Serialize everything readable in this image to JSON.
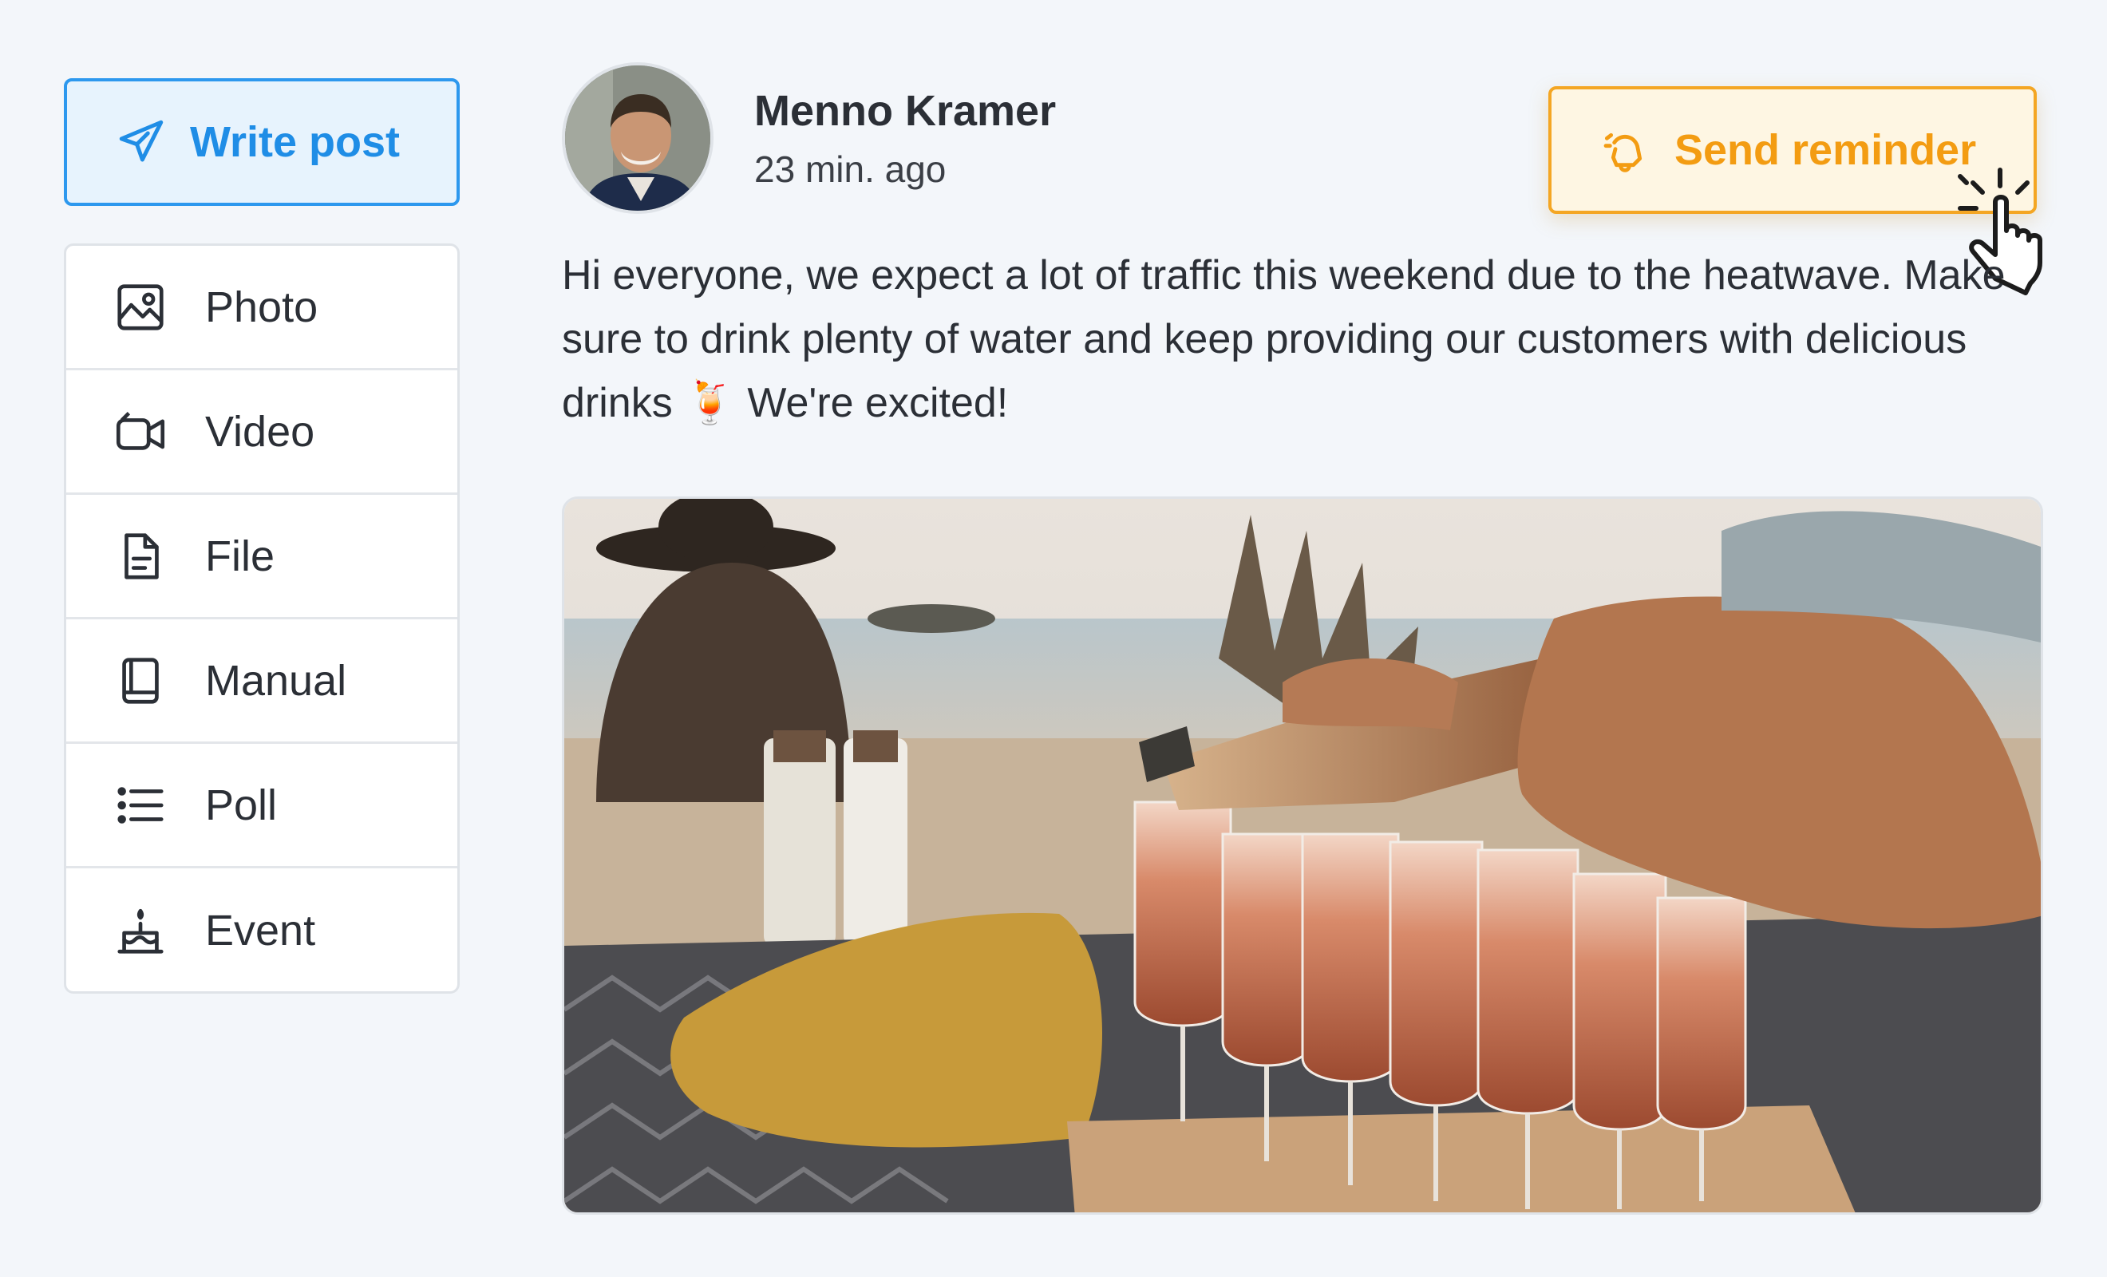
{
  "sidebar": {
    "write_post": {
      "label": "Write post",
      "icon": "paper-plane-icon"
    },
    "items": [
      {
        "label": "Photo",
        "icon": "image-icon"
      },
      {
        "label": "Video",
        "icon": "video-camera-icon"
      },
      {
        "label": "File",
        "icon": "file-icon"
      },
      {
        "label": "Manual",
        "icon": "book-icon"
      },
      {
        "label": "Poll",
        "icon": "list-icon"
      },
      {
        "label": "Event",
        "icon": "cake-icon"
      }
    ]
  },
  "post": {
    "author": "Menno Kramer",
    "time": "23 min. ago",
    "text": "Hi everyone, we expect a lot of traffic this weekend due to the heatwave. Make sure to drink plenty of water and keep providing our customers with delicious drinks 🍹 We're excited!"
  },
  "reminder": {
    "label": "Send reminder",
    "icon": "bell-ringing-icon"
  },
  "colors": {
    "accent_blue": "#1f8de6",
    "accent_orange": "#f39c12",
    "background": "#f3f6fa"
  }
}
